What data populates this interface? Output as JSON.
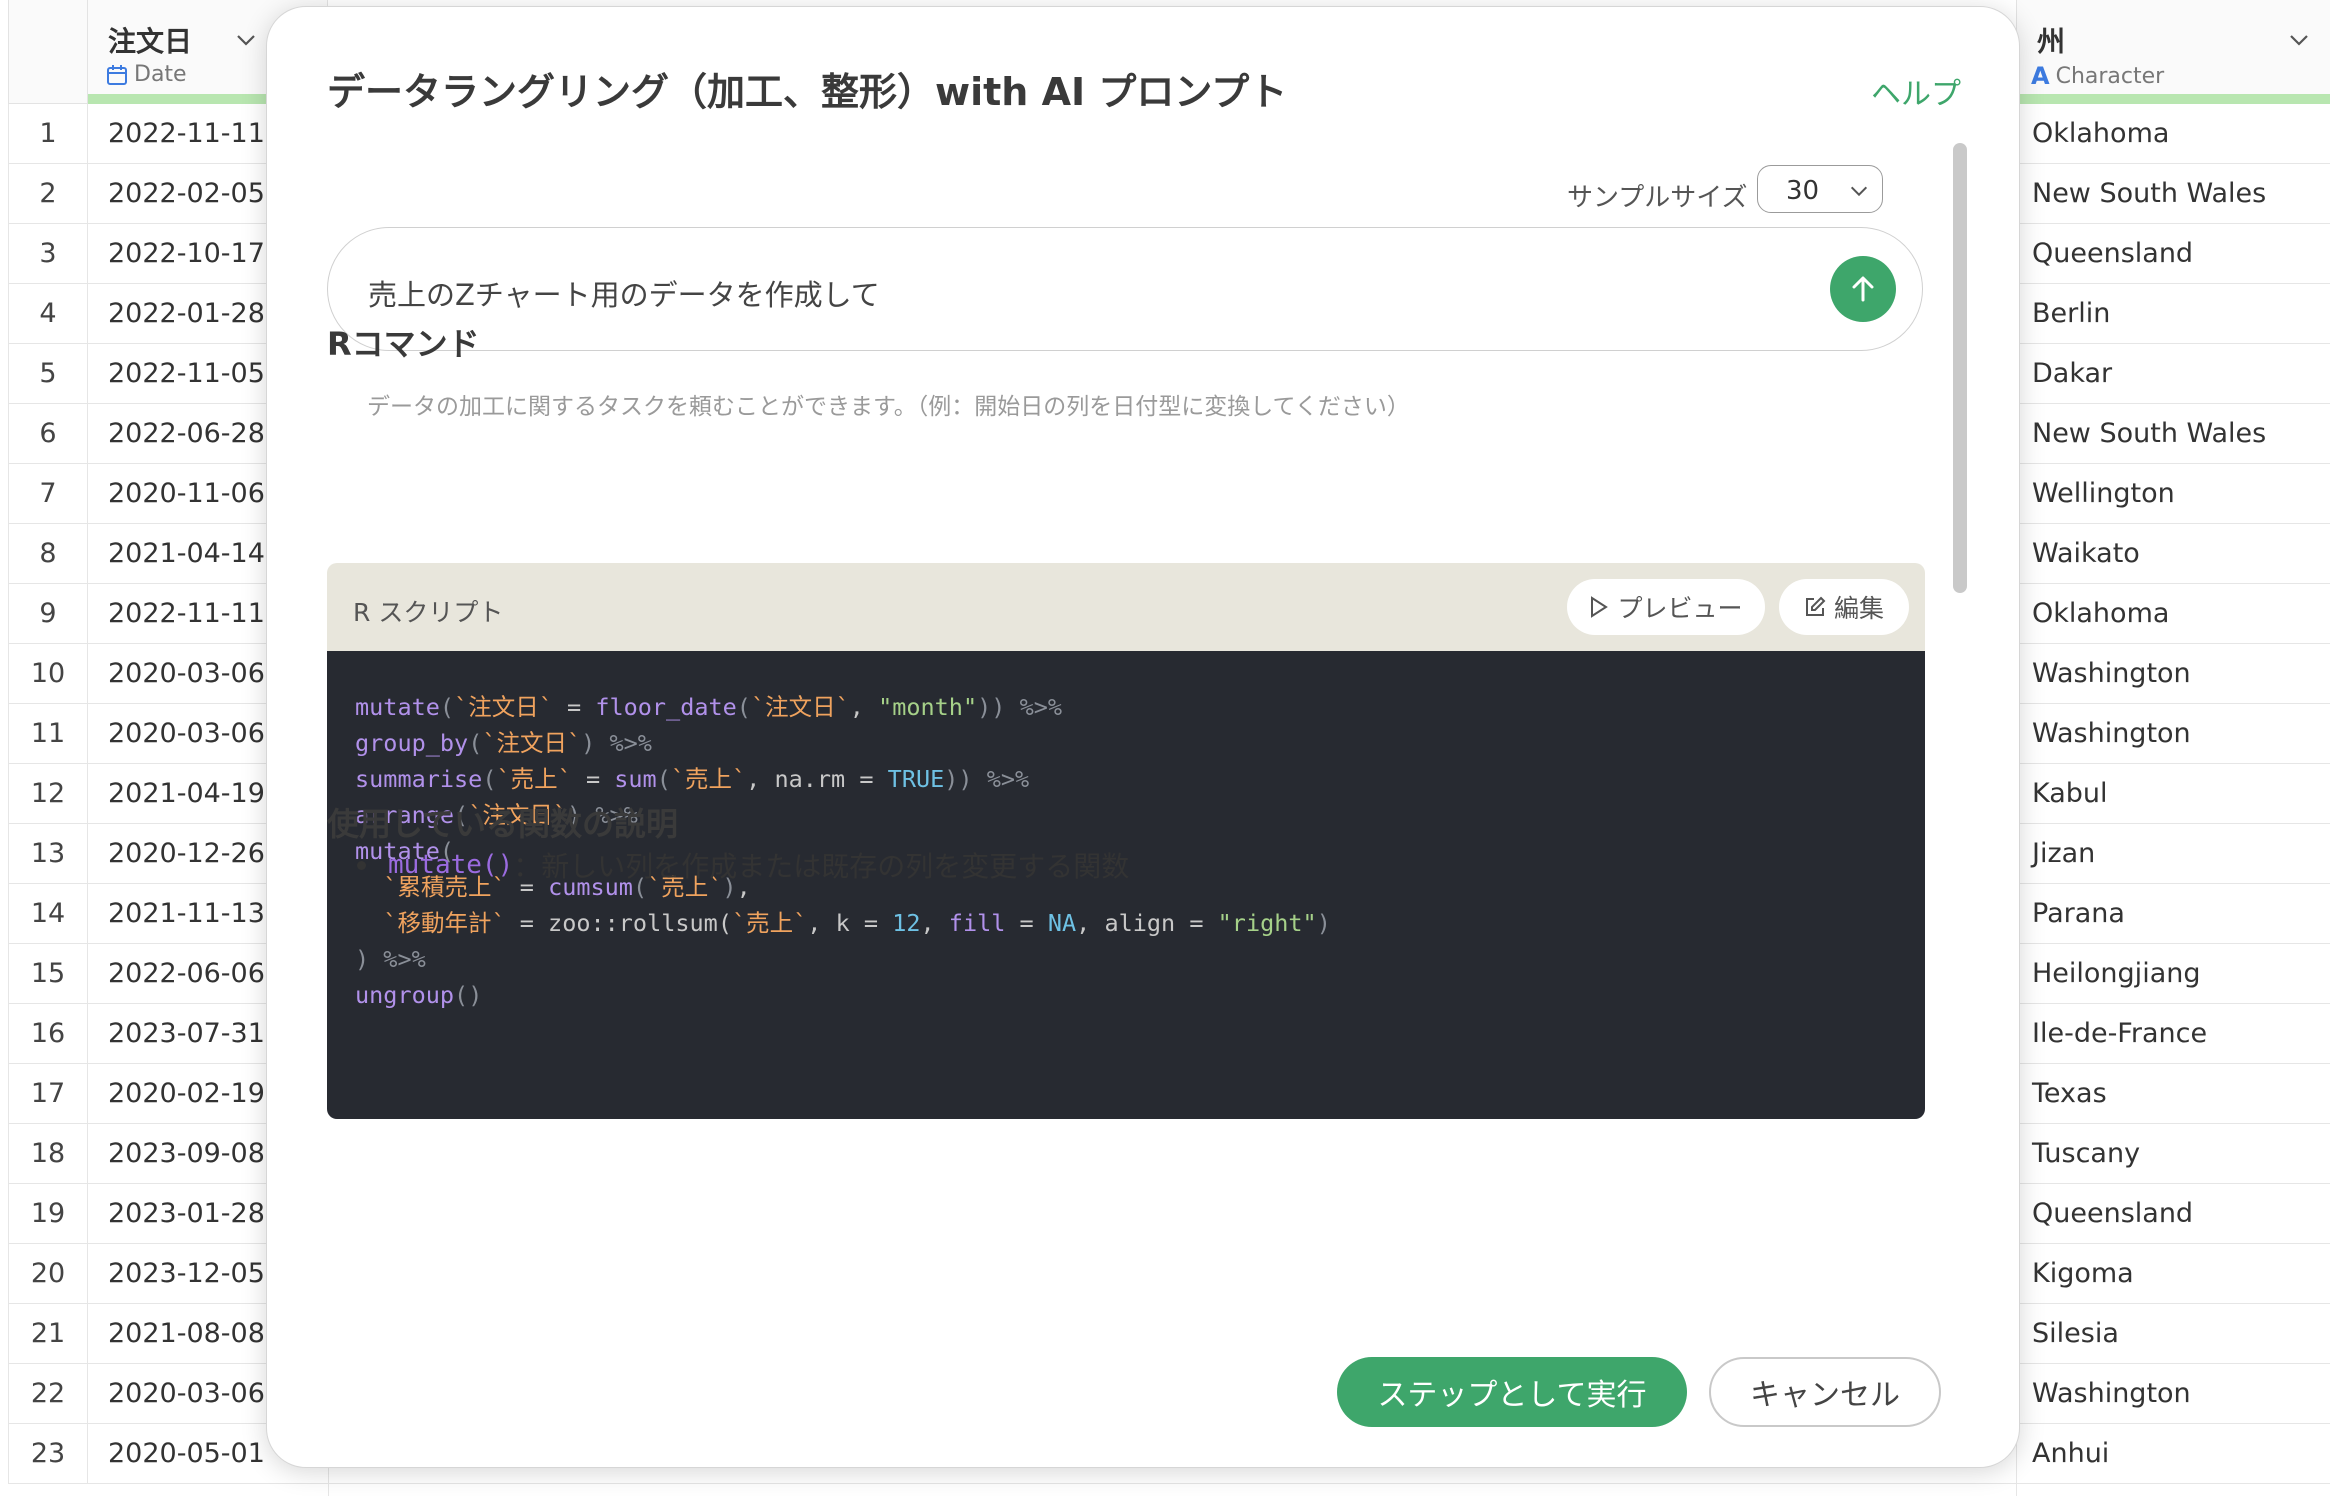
{
  "grid": {
    "date_column": {
      "name": "注文日",
      "type": "Date",
      "type_icon": "calendar-icon"
    },
    "state_column": {
      "name": "州",
      "type": "Character",
      "type_icon": "character-type-icon"
    },
    "rows": [
      {
        "num": "1",
        "date": "2022-11-11",
        "state": "Oklahoma"
      },
      {
        "num": "2",
        "date": "2022-02-05",
        "state": "New South Wales"
      },
      {
        "num": "3",
        "date": "2022-10-17",
        "state": "Queensland"
      },
      {
        "num": "4",
        "date": "2022-01-28",
        "state": "Berlin"
      },
      {
        "num": "5",
        "date": "2022-11-05",
        "state": "Dakar"
      },
      {
        "num": "6",
        "date": "2022-06-28",
        "state": "New South Wales"
      },
      {
        "num": "7",
        "date": "2020-11-06",
        "state": "Wellington"
      },
      {
        "num": "8",
        "date": "2021-04-14",
        "state": "Waikato"
      },
      {
        "num": "9",
        "date": "2022-11-11",
        "state": "Oklahoma"
      },
      {
        "num": "10",
        "date": "2020-03-06",
        "state": "Washington"
      },
      {
        "num": "11",
        "date": "2020-03-06",
        "state": "Washington"
      },
      {
        "num": "12",
        "date": "2021-04-19",
        "state": "Kabul"
      },
      {
        "num": "13",
        "date": "2020-12-26",
        "state": "Jizan"
      },
      {
        "num": "14",
        "date": "2021-11-13",
        "state": "Parana"
      },
      {
        "num": "15",
        "date": "2022-06-06",
        "state": "Heilongjiang"
      },
      {
        "num": "16",
        "date": "2023-07-31",
        "state": "Ile-de-France"
      },
      {
        "num": "17",
        "date": "2020-02-19",
        "state": "Texas"
      },
      {
        "num": "18",
        "date": "2023-09-08",
        "state": "Tuscany"
      },
      {
        "num": "19",
        "date": "2023-01-28",
        "state": "Queensland"
      },
      {
        "num": "20",
        "date": "2023-12-05",
        "state": "Kigoma"
      },
      {
        "num": "21",
        "date": "2021-08-08",
        "state": "Silesia"
      },
      {
        "num": "22",
        "date": "2020-03-06",
        "state": "Washington"
      },
      {
        "num": "23",
        "date": "2020-05-01",
        "state": "Anhui"
      }
    ]
  },
  "modal": {
    "title": "データラングリング（加工、整形）with AI プロンプト",
    "help_label": "ヘルプ",
    "sample_size_label": "サンプルサイズ",
    "sample_size_value": "30",
    "prompt_text": "売上のZチャート用のデータを作成して",
    "hint": "データの加工に関するタスクを頼むことができます。（例：開始日の列を日付型に変換してください）",
    "r_command_title": "Rコマンド",
    "r_script_label": "R スクリプト",
    "preview_label": "プレビュー",
    "edit_label": "編集",
    "functions_title": "使用している関数の説明",
    "functions": [
      {
        "name": "mutate()",
        "description": "：新しい列を作成または既存の列を変更する関数"
      }
    ],
    "run_label": "ステップとして実行",
    "cancel_label": "キャンセル",
    "accent_color": "#3ea66b"
  }
}
